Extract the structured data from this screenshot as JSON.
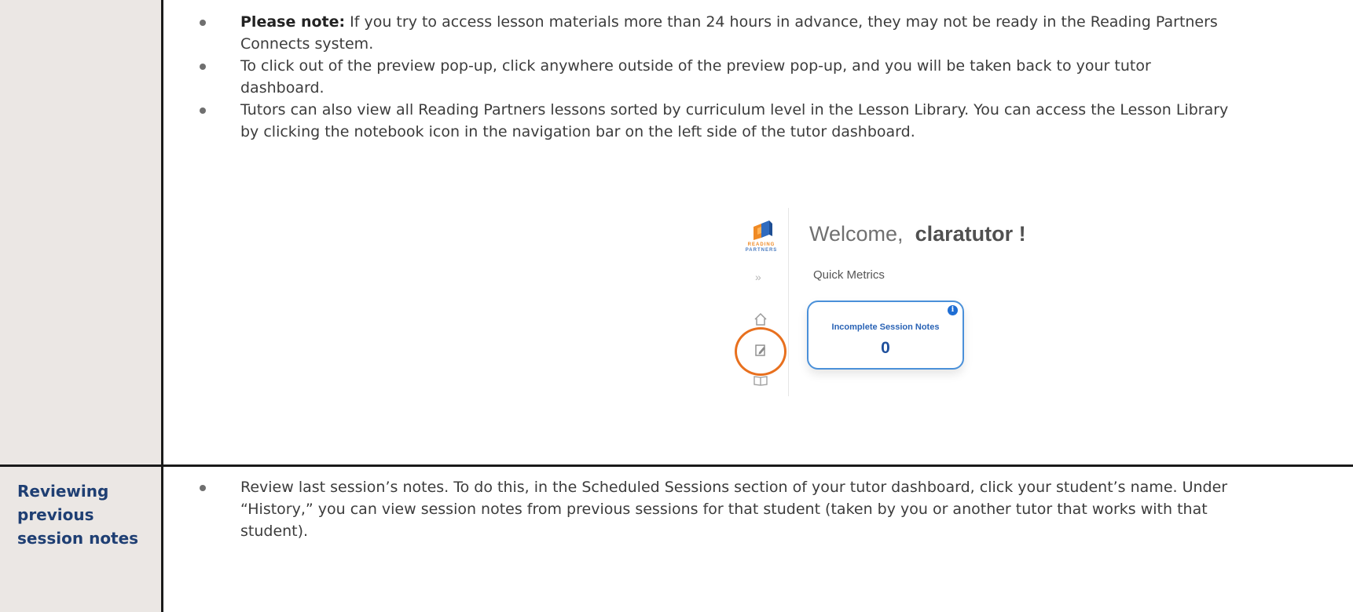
{
  "rows": [
    {
      "label": "",
      "bullets": [
        {
          "bold_prefix": "Please note:",
          "text": " If you try to access lesson materials more than 24 hours in advance, they may not be ready in the Reading Partners Connects system."
        },
        {
          "bold_prefix": "",
          "text": "To click out of the preview pop-up, click anywhere outside of the preview pop-up, and you will be taken back to your tutor dashboard."
        },
        {
          "bold_prefix": "",
          "text": "Tutors can also view all Reading Partners lessons sorted by curriculum level in the Lesson Library. You can access the Lesson Library by clicking the notebook icon in the navigation bar on the left side of the tutor dashboard."
        }
      ]
    },
    {
      "label": "Reviewing previous session notes",
      "bullets": [
        {
          "bold_prefix": "",
          "text": "Review last session’s notes. To do this, in the Scheduled Sessions section of your tutor dashboard, click your student’s name. Under “History,” you can view session notes from previous sessions for that student (taken by you or another tutor that works with that student)."
        }
      ]
    }
  ],
  "screenshot": {
    "logo_line1": "READING",
    "logo_line2": "PARTNERS",
    "expand_glyph": "»",
    "welcome_prefix": "Welcome,",
    "username": "claratutor !",
    "metrics_label": "Quick Metrics",
    "card_title": "Incomplete Session Notes",
    "card_value": "0",
    "info_glyph": "i",
    "icons": [
      "home-icon",
      "notebook-icon",
      "book-icon"
    ],
    "highlight_color": "#e8701e",
    "card_color": "#4a90d9"
  }
}
